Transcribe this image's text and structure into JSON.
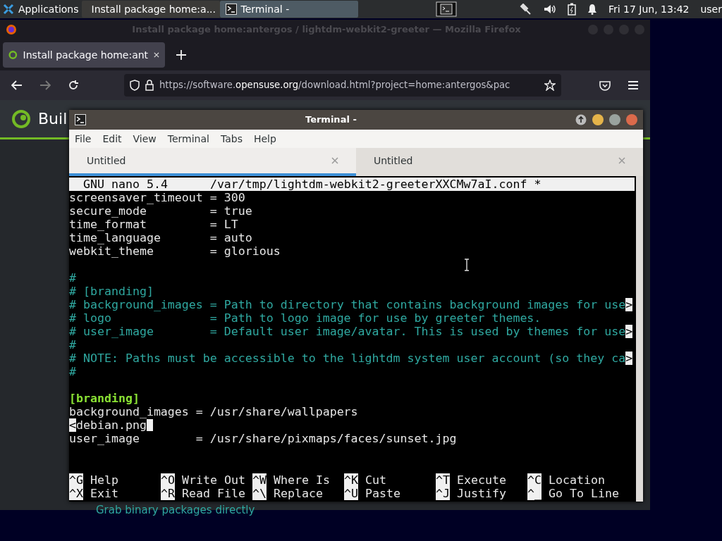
{
  "panel": {
    "apps_label": "Applications",
    "tasks": [
      {
        "title": "Install package home:a...",
        "kind": "browser",
        "selected": false
      },
      {
        "title": "Terminal -",
        "kind": "terminal",
        "selected": true
      }
    ],
    "clock": "Fri 17 Jun, 13:42",
    "user": "user"
  },
  "firefox": {
    "title": "Install package home:antergos / lightdm-webkit2-greeter — Mozilla Firefox",
    "tab_label": "Install package home:ant",
    "url_prefix": "https://software.",
    "url_domain": "opensuse.org",
    "url_rest": "/download.html?project=home:antergos&pac",
    "page_heading": "Buil",
    "page_text": "Grab binary packages directly"
  },
  "terminal": {
    "title": "Terminal -",
    "menu": [
      "File",
      "Edit",
      "View",
      "Terminal",
      "Tabs",
      "Help"
    ],
    "tabs": [
      {
        "label": "Untitled",
        "selected": true
      },
      {
        "label": "Untitled",
        "selected": false
      }
    ],
    "nano": {
      "version": "GNU nano 5.4",
      "file": "/var/tmp/lightdm-webkit2-greeterXXCMw7aI.conf *",
      "lines": [
        {
          "kind": "plain",
          "text": "screensaver_timeout = 300"
        },
        {
          "kind": "plain",
          "text": "secure_mode         = true"
        },
        {
          "kind": "plain",
          "text": "time_format         = LT"
        },
        {
          "kind": "plain",
          "text": "time_language       = auto"
        },
        {
          "kind": "plain",
          "text": "webkit_theme        = glorious"
        },
        {
          "kind": "blank"
        },
        {
          "kind": "comment",
          "text": "#"
        },
        {
          "kind": "comment",
          "text": "# [branding]"
        },
        {
          "kind": "comment",
          "text": "# background_images = Path to directory that contains background images for use",
          "more": ">"
        },
        {
          "kind": "comment",
          "text": "# logo              = Path to logo image for use by greeter themes."
        },
        {
          "kind": "comment",
          "text": "# user_image        = Default user image/avatar. This is used by themes for use",
          "more": ">"
        },
        {
          "kind": "comment",
          "text": "#"
        },
        {
          "kind": "comment",
          "text": "# NOTE: Paths must be accessible to the lightdm system user account (so they ca",
          "more": ">"
        },
        {
          "kind": "comment",
          "text": "#"
        },
        {
          "kind": "blank"
        },
        {
          "kind": "section",
          "text": "[branding]"
        },
        {
          "kind": "plain",
          "text": "background_images = /usr/share/wallpapers"
        },
        {
          "kind": "input",
          "marker": "<",
          "text": "debian.png",
          "cursor": true
        },
        {
          "kind": "plain",
          "text": "user_image        = /usr/share/pixmaps/faces/sunset.jpg"
        }
      ],
      "shortcuts": [
        {
          "key": "^G",
          "label": "Help"
        },
        {
          "key": "^O",
          "label": "Write Out"
        },
        {
          "key": "^W",
          "label": "Where Is"
        },
        {
          "key": "^K",
          "label": "Cut"
        },
        {
          "key": "^T",
          "label": "Execute"
        },
        {
          "key": "^C",
          "label": "Location"
        },
        {
          "key": "^X",
          "label": "Exit"
        },
        {
          "key": "^R",
          "label": "Read File"
        },
        {
          "key": "^\\",
          "label": "Replace"
        },
        {
          "key": "^U",
          "label": "Paste"
        },
        {
          "key": "^J",
          "label": "Justify"
        },
        {
          "key": "^_",
          "label": "Go To Line"
        }
      ]
    }
  }
}
